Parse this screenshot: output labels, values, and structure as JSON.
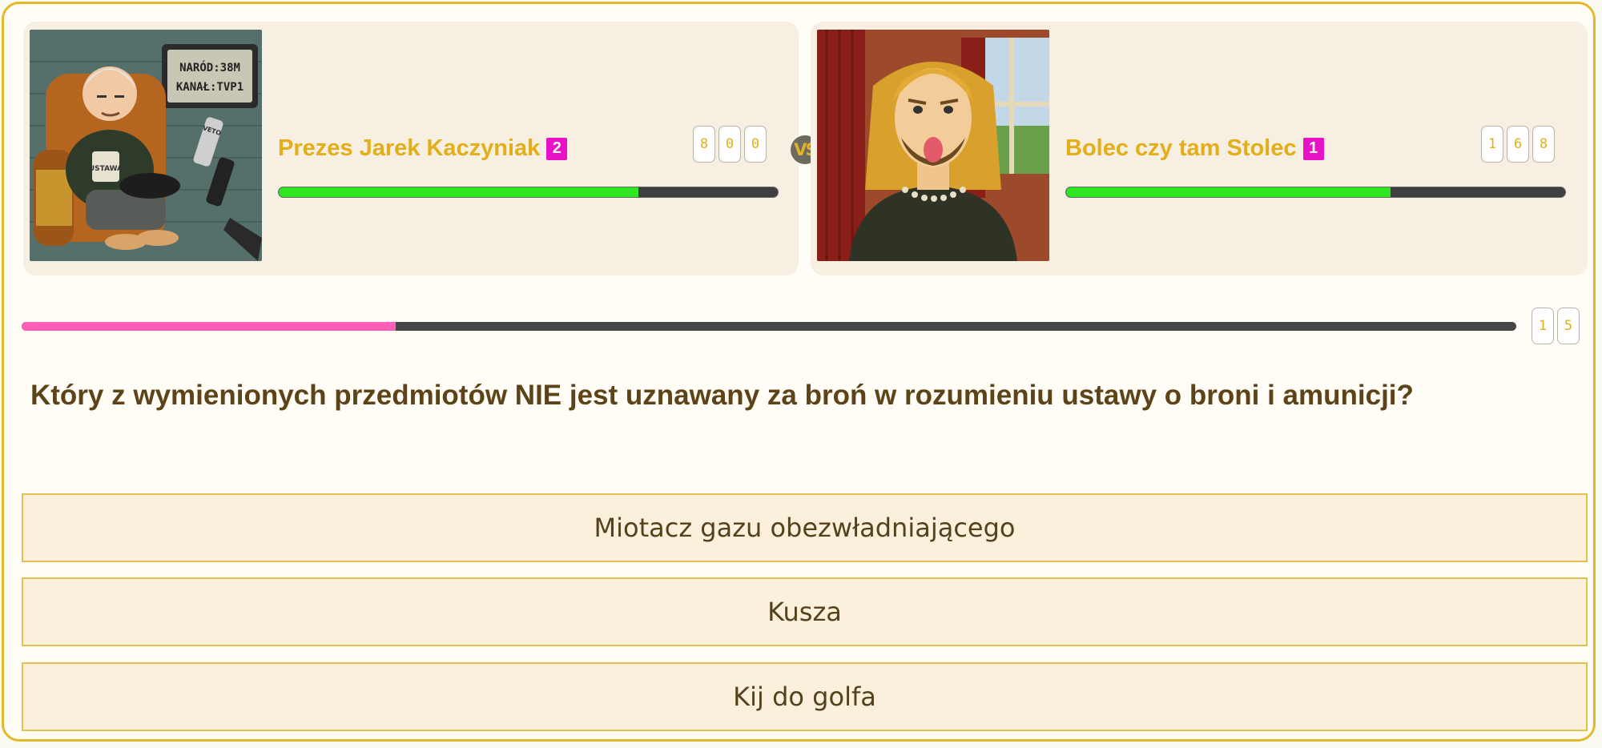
{
  "players": [
    {
      "name": "Prezes Jarek Kaczyniak",
      "rank": "2",
      "score_digits": [
        "8",
        "0",
        "0"
      ],
      "hp_fraction": 0.72,
      "avatar": {
        "description_icon": "cartoon-old-man-in-armchair",
        "tv_line1": "NARÓD:38M",
        "tv_line2": "KANAŁ:TVP1",
        "mug_text": "USTAWA",
        "remote_text": "VETO"
      }
    },
    {
      "name": "Bolec czy tam Stolec",
      "rank": "1",
      "score_digits": [
        "1",
        "6",
        "8"
      ],
      "hp_fraction": 0.65,
      "avatar": {
        "description_icon": "cartoon-long-haired-man-tongue-out"
      }
    }
  ],
  "vs_label": "VS",
  "round": {
    "progress_fraction": 0.25,
    "counter_digits": [
      "1",
      "5"
    ]
  },
  "question": "Który z wymienionych przedmiotów NIE jest uznawany za broń w rozumieniu ustawy o broni i amunicji?",
  "answers": [
    "Miotacz gazu obezwładniającego",
    "Kusza",
    "Kij do golfa"
  ],
  "colors": {
    "frame": "#e4b929",
    "name": "#e3ae17",
    "rank_badge": "#e812c9",
    "hp_fill": "#2de821",
    "progress_fill": "#ff5fb7",
    "question_text": "#5d4418",
    "answer_bg": "#faf0dc"
  }
}
